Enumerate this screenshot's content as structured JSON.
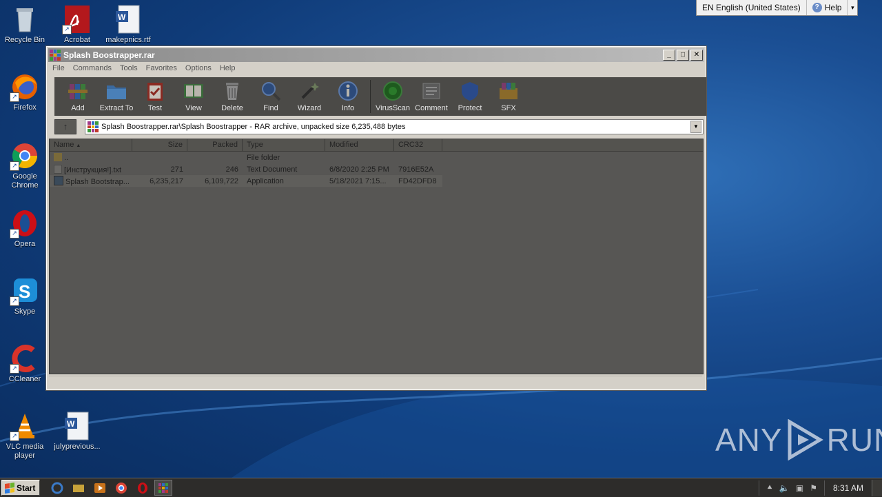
{
  "desktop": {
    "icons": [
      {
        "label": "Recycle Bin"
      },
      {
        "label": "Acrobat"
      },
      {
        "label": "makepnics.rtf"
      },
      {
        "label": "Firefox"
      },
      {
        "label": "Google Chrome"
      },
      {
        "label": "Opera"
      },
      {
        "label": "Skype"
      },
      {
        "label": "CCleaner"
      },
      {
        "label": "VLC media player"
      },
      {
        "label": "julyprevious..."
      }
    ]
  },
  "langbar": {
    "language": "EN English (United States)",
    "help": "Help"
  },
  "window": {
    "title": "Splash Boostrapper.rar",
    "controls": {
      "minimize": "_",
      "maximize": "□",
      "close": "✕"
    },
    "menu": [
      "File",
      "Commands",
      "Tools",
      "Favorites",
      "Options",
      "Help"
    ],
    "toolbar": [
      "Add",
      "Extract To",
      "Test",
      "View",
      "Delete",
      "Find",
      "Wizard",
      "Info",
      "VirusScan",
      "Comment",
      "Protect",
      "SFX"
    ],
    "address": "Splash Boostrapper.rar\\Splash Boostrapper - RAR archive, unpacked size 6,235,488 bytes",
    "columns": {
      "name": "Name",
      "size": "Size",
      "packed": "Packed",
      "type": "Type",
      "modified": "Modified",
      "crc": "CRC32"
    },
    "rows": [
      {
        "name": "..",
        "size": "",
        "packed": "",
        "type": "File folder",
        "modified": "",
        "crc": ""
      },
      {
        "name": "[Инструкция!].txt",
        "size": "271",
        "packed": "246",
        "type": "Text Document",
        "modified": "6/8/2020 2:25 PM",
        "crc": "7916E52A"
      },
      {
        "name": "Splash Bootstrap...",
        "size": "6,235,217",
        "packed": "6,109,722",
        "type": "Application",
        "modified": "5/18/2021 7:15...",
        "crc": "FD42DFD8"
      }
    ]
  },
  "watermark": {
    "left": "ANY",
    "right": "RUN"
  },
  "taskbar": {
    "start": "Start",
    "clock": "8:31 AM"
  },
  "colors": {
    "desktop": "#1b4f94",
    "dim_panel": "#575654",
    "window_frame": "#d4d0c8"
  }
}
